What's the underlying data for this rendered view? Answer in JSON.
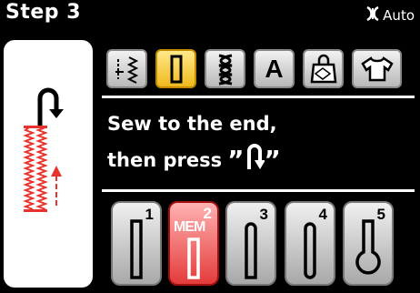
{
  "header": {
    "title": "Step 3",
    "auto_label": "Auto",
    "auto_icon": "presser-foot-auto-icon"
  },
  "left_panel": {
    "icons": [
      "reverse-stitch-arrow-icon",
      "buttonhole-stitch-preview"
    ],
    "colors": {
      "stitch": "#e8322d"
    }
  },
  "categories": [
    {
      "icon": "utility-stitch-icon",
      "selected": false
    },
    {
      "icon": "buttonhole-category-icon",
      "selected": true
    },
    {
      "icon": "decorative-stitch-icon",
      "selected": false
    },
    {
      "label": "A",
      "icon": "letter-a-icon",
      "selected": false
    },
    {
      "icon": "quilting-bag-icon",
      "selected": false
    },
    {
      "icon": "shirt-icon",
      "selected": false
    }
  ],
  "instruction": {
    "line1": "Sew to the end,",
    "line2": "then press",
    "open_quote": "”",
    "close_quote": "”",
    "button_icon": "reverse-button-icon"
  },
  "stitches": [
    {
      "number": "1",
      "selected": false
    },
    {
      "number": "2",
      "label": "MEM",
      "selected": true
    },
    {
      "number": "3",
      "selected": false
    },
    {
      "number": "4",
      "selected": false
    },
    {
      "number": "5",
      "selected": false
    }
  ],
  "colors": {
    "selected_category": "#f5c22a",
    "memory_red": "#e43b3b",
    "background": "#000000"
  }
}
